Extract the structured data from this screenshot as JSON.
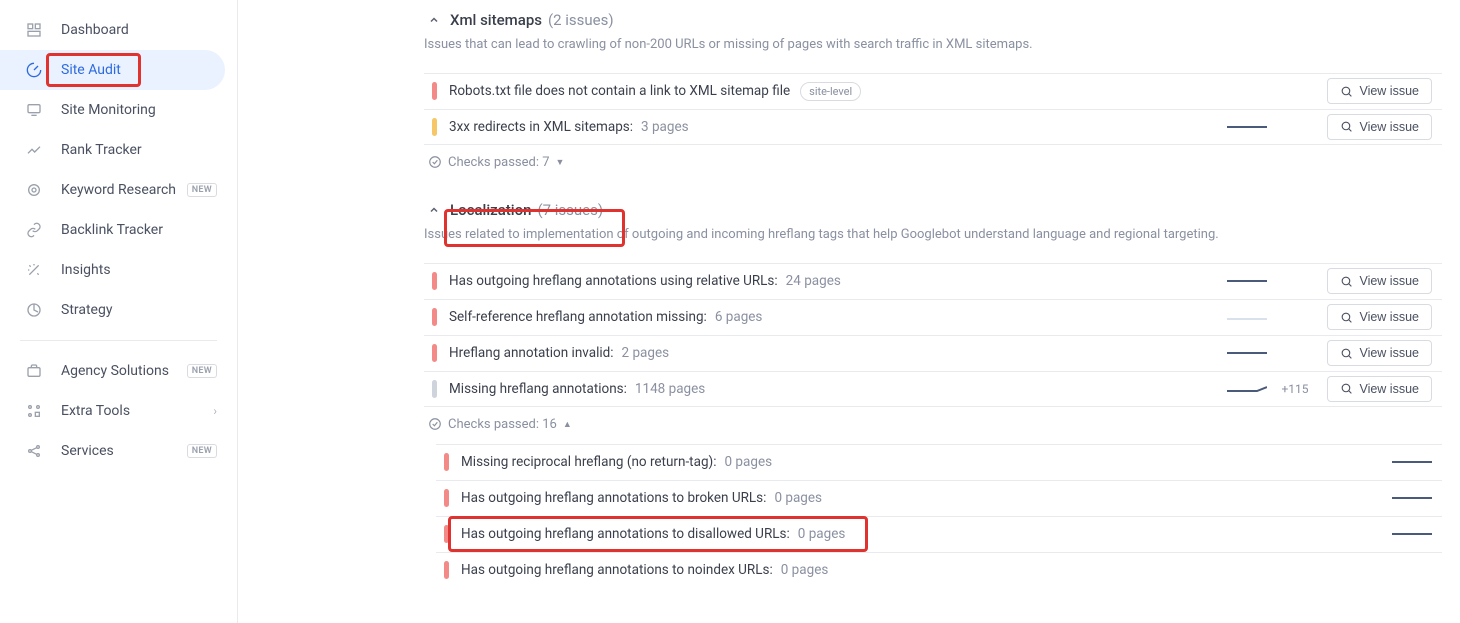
{
  "sidebar": {
    "items": [
      {
        "label": "Dashboard"
      },
      {
        "label": "Site Audit"
      },
      {
        "label": "Site Monitoring"
      },
      {
        "label": "Rank Tracker"
      },
      {
        "label": "Keyword Research",
        "badge": "NEW"
      },
      {
        "label": "Backlink Tracker"
      },
      {
        "label": "Insights"
      },
      {
        "label": "Strategy"
      }
    ],
    "secondaryItems": [
      {
        "label": "Agency Solutions",
        "badge": "NEW"
      },
      {
        "label": "Extra Tools",
        "chevron": true
      },
      {
        "label": "Services",
        "badge": "NEW"
      }
    ]
  },
  "sections": {
    "sitemaps": {
      "title": "Xml sitemaps",
      "count": "(2 issues)",
      "desc": "Issues that can lead to crawling of non-200 URLs or missing of pages with search traffic in XML sitemaps.",
      "issues": [
        {
          "text": "Robots.txt file does not contain a link to XML sitemap file",
          "tag": "site-level"
        },
        {
          "text": "3xx redirects in XML sitemaps:",
          "pages": "3 pages"
        }
      ],
      "passed": "Checks passed: 7"
    },
    "localization": {
      "title": "Localization",
      "count": "(7 issues)",
      "desc": "Issues related to implementation of outgoing and incoming hreflang tags that help Googlebot understand language and regional targeting.",
      "issues": [
        {
          "text": "Has outgoing hreflang annotations using relative URLs:",
          "pages": "24 pages"
        },
        {
          "text": "Self-reference hreflang annotation missing:",
          "pages": "6 pages"
        },
        {
          "text": "Hreflang annotation invalid:",
          "pages": "2 pages"
        },
        {
          "text": "Missing hreflang annotations:",
          "pages": "1148 pages",
          "plus": "+115"
        }
      ],
      "passed": "Checks passed: 16",
      "passedIssues": [
        {
          "text": "Missing reciprocal hreflang (no return-tag):",
          "pages": "0 pages"
        },
        {
          "text": "Has outgoing hreflang annotations to broken URLs:",
          "pages": "0 pages"
        },
        {
          "text": "Has outgoing hreflang annotations to disallowed URLs:",
          "pages": "0 pages"
        },
        {
          "text": "Has outgoing hreflang annotations to noindex URLs:",
          "pages": "0 pages"
        }
      ]
    }
  },
  "buttons": {
    "viewIssue": "View issue"
  }
}
